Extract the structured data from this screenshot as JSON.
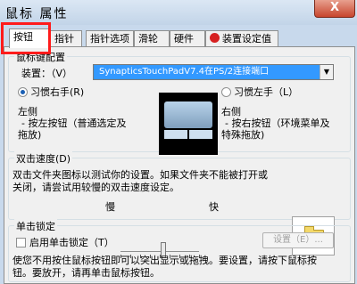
{
  "window": {
    "title": "鼠标 属性",
    "close_label": "X"
  },
  "tabs": [
    {
      "label": "按钮"
    },
    {
      "label": "指针"
    },
    {
      "label": "指针选项"
    },
    {
      "label": "滑轮"
    },
    {
      "label": "硬件"
    },
    {
      "label": "装置设定值"
    }
  ],
  "button_config": {
    "legend": "鼠标键配置",
    "device_label": "装置：（V）",
    "device_value": "SynapticsTouchPadV7.4在PS/2连接端口",
    "right_hand_label": "习惯右手(R)",
    "left_hand_label": "习惯左手（L）",
    "left_side_title": "左侧",
    "left_side_desc_1": "- 按左按钮（普通选定及",
    "left_side_desc_2": "拖放)",
    "right_side_title": "右侧",
    "right_side_desc_1": "- 按右按钮（环境菜单及",
    "right_side_desc_2": "特殊拖放)"
  },
  "double_click": {
    "legend": "双击速度(D)",
    "desc_1": "双击文件夹图标以测试你的设置。如果文件夹不能被打开或",
    "desc_2": "关闭，请尝试用较慢的双击速度设定。",
    "slow_label": "慢",
    "fast_label": "快",
    "speed_value": 0.5
  },
  "click_lock": {
    "legend": "单击锁定",
    "enable_label": "启用单击锁定（T）",
    "settings_label": "设置（E）...",
    "desc_1": "使您不用按住鼠标按钮即可以突出显示或拖拽。要设置，请按下鼠标按",
    "desc_2": "钮。要放开，请再单击鼠标按钮。"
  },
  "colors": {
    "highlight": "#ff1b1b",
    "selection": "#3399ff",
    "close": "#c7452d"
  },
  "icons": [
    "close-icon",
    "device-settings-icon",
    "touchpad-icon",
    "folder-icon"
  ]
}
